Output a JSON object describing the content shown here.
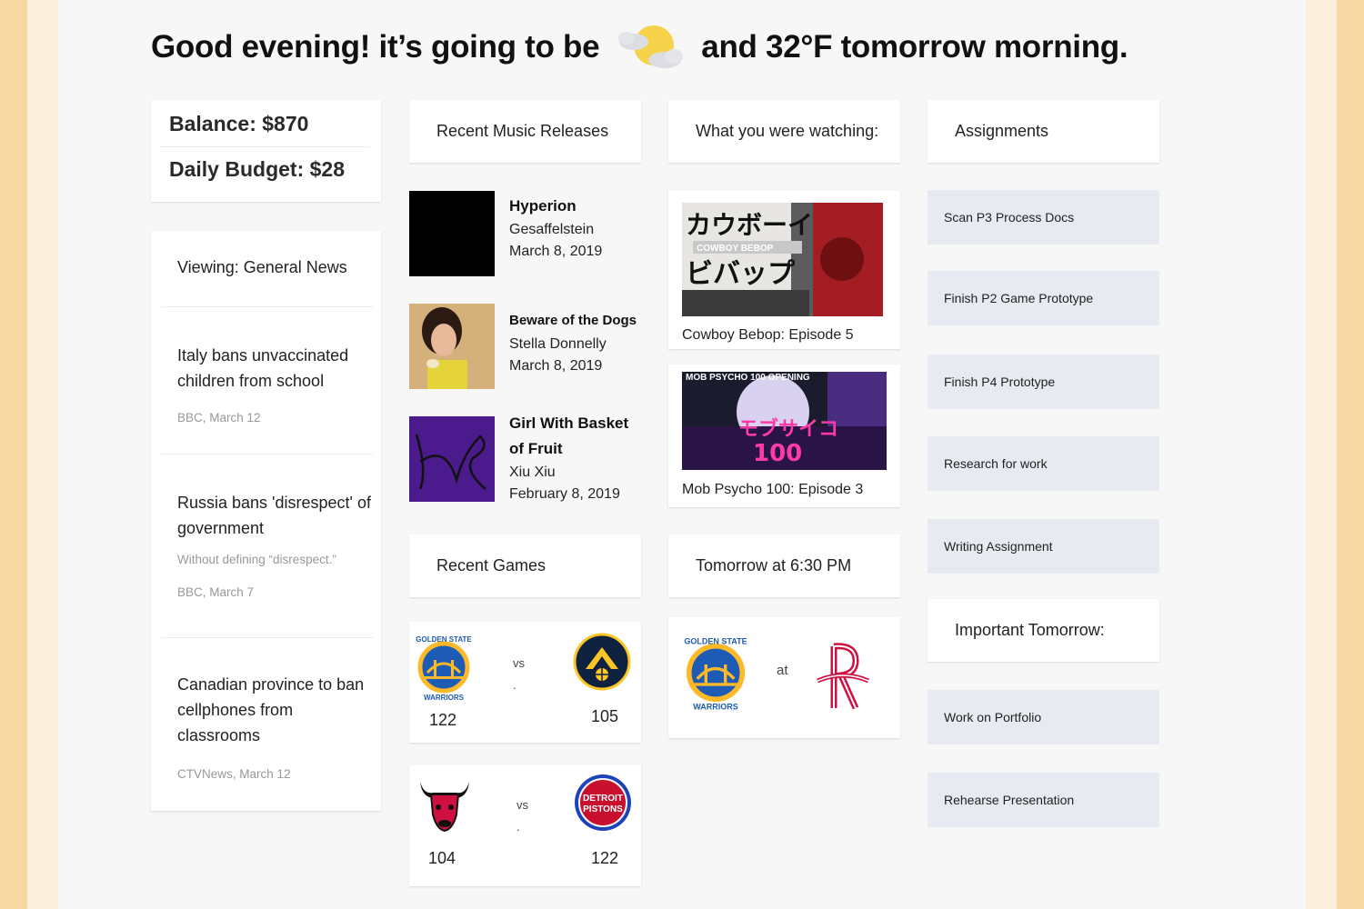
{
  "greeting": {
    "prefix": "Good evening!  it’s going to be",
    "suffix": "and 32°F tomorrow morning.",
    "weather_icon": "partly-cloudy-moon-icon"
  },
  "budget": {
    "balance": "Balance: $870",
    "daily": "Daily Budget: $28"
  },
  "news": {
    "title": "Viewing: General News",
    "items": [
      {
        "headline": "Italy bans unvaccinated children from school",
        "subtitle": "",
        "source": "BBC, March 12"
      },
      {
        "headline": "Russia bans 'disrespect' of government",
        "subtitle": "Without defining “disrespect.”",
        "source": "BBC, March 7"
      },
      {
        "headline": "Canadian province to ban cellphones from classrooms",
        "subtitle": "",
        "source": "CTVNews, March 12"
      }
    ]
  },
  "music": {
    "title": "Recent Music Releases",
    "albums": [
      {
        "title": "Hyperion",
        "artist": "Gesaffelstein",
        "date": "March 8, 2019",
        "art_color": "#000000"
      },
      {
        "title": "Beware of the Dogs",
        "artist": "Stella Donnelly",
        "date": "March 8, 2019",
        "art_color": "#c9a36b"
      },
      {
        "title": "Girl With Basket of Fruit",
        "artist": "Xiu Xiu",
        "date": "February 8, 2019",
        "art_color": "#4a1a8c"
      }
    ]
  },
  "watching": {
    "title": "What you were watching:",
    "items": [
      {
        "caption": "Cowboy Bebop: Episode 5",
        "thumb_text_1": "カウボーイ",
        "thumb_text_2": "COWBOY BEBOP",
        "thumb_text_3": "ビバップ"
      },
      {
        "caption": "Mob Psycho 100: Episode 3",
        "thumb_text_1": "MOB PSYCHO 100 OPENING",
        "thumb_text_2": "モブサイコ",
        "thumb_text_3": "100"
      }
    ]
  },
  "games": {
    "title": "Recent Games",
    "results": [
      {
        "home_score": "122",
        "away_score": "105",
        "vs": "vs",
        "dot": "."
      },
      {
        "home_score": "104",
        "away_score": "122",
        "vs": "vs",
        "dot": "."
      }
    ]
  },
  "upcoming": {
    "title": "Tomorrow at 6:30 PM",
    "at": "at"
  },
  "logos": {
    "warriors_top": "GOLDEN STATE",
    "warriors_bottom": "WARRIORS",
    "pistons_1": "DETROIT",
    "pistons_2": "PISTONS"
  },
  "assignments": {
    "title": "Assignments",
    "items": [
      "Scan P3 Process Docs",
      "Finish P2 Game Prototype",
      "Finish P4 Prototype",
      "Research for work",
      "Writing Assignment"
    ]
  },
  "important": {
    "title": "Important Tomorrow:",
    "items": [
      "Work on Portfolio",
      "Rehearse Presentation"
    ]
  }
}
